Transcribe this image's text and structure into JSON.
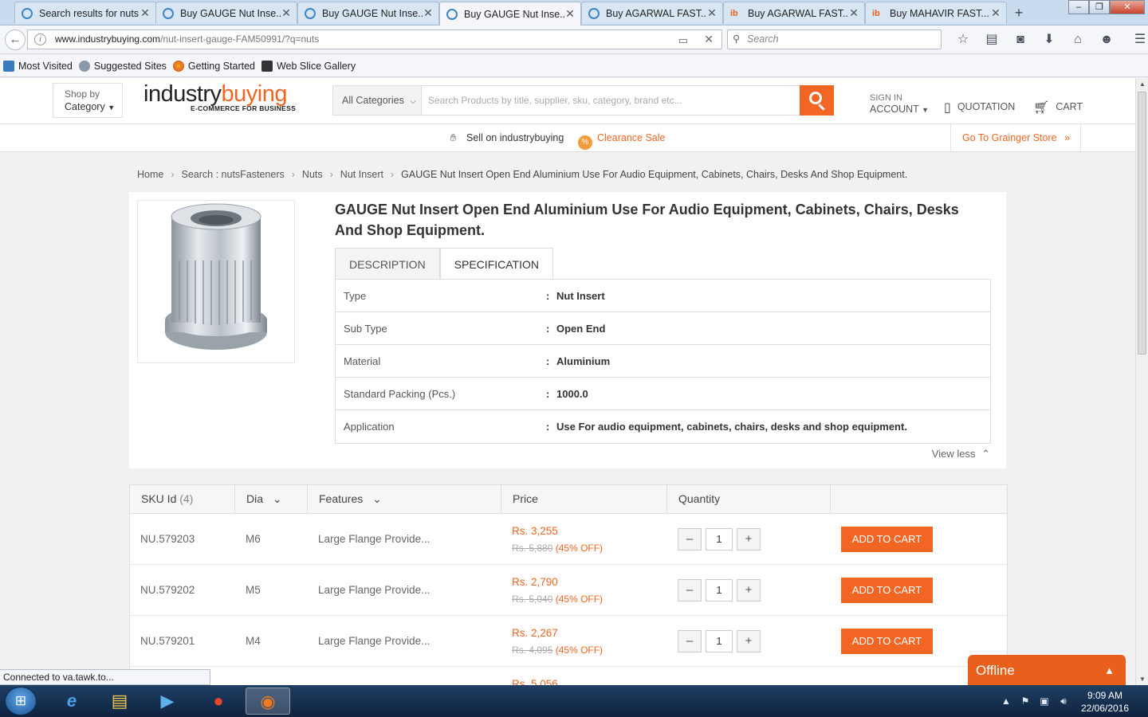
{
  "browser": {
    "tabs": [
      {
        "label": "Search results for nuts",
        "icon": "loading-icon"
      },
      {
        "label": "Buy GAUGE Nut Inse...",
        "icon": "loading-icon"
      },
      {
        "label": "Buy GAUGE Nut Inse...",
        "icon": "loading-icon"
      },
      {
        "label": "Buy GAUGE Nut Inse...",
        "icon": "loading-icon",
        "active": true
      },
      {
        "label": "Buy AGARWAL FAST...",
        "icon": "loading-icon"
      },
      {
        "label": "Buy AGARWAL FAST...",
        "icon": "ib-favicon"
      },
      {
        "label": "Buy MAHAVIR FAST...",
        "icon": "ib-favicon"
      }
    ],
    "url_host": "www.industrybuying.com",
    "url_path": "/nut-insert-gauge-FAM50991/?q=nuts",
    "search_placeholder": "Search",
    "bookmarks": [
      "Most Visited",
      "Suggested Sites",
      "Getting Started",
      "Web Slice Gallery"
    ],
    "status_text": "Connected to va.tawk.to..."
  },
  "site": {
    "shop_by": "Shop by",
    "shop_category": "Category",
    "logo_part1": "industry",
    "logo_part2": "buying",
    "logo_tagline": "E-COMMERCE FOR BUSINESS",
    "all_categories": "All Categories",
    "search_placeholder": "Search Products by title, supplier, sku, category, brand etc...",
    "sign_in": "SIGN IN",
    "account": "ACCOUNT",
    "quotation": "QUOTATION",
    "cart": "CART",
    "sell": "Sell on industrybuying",
    "clearance": "Clearance Sale",
    "grainger": "Go To Grainger Store",
    "brand_color": "#f26522"
  },
  "breadcrumb": [
    "Home",
    "Search : nutsFasteners",
    "Nuts",
    "Nut Insert",
    "GAUGE Nut Insert Open End Aluminium Use For Audio Equipment, Cabinets, Chairs, Desks And Shop Equipment."
  ],
  "product": {
    "title": "GAUGE Nut Insert Open End Aluminium Use For Audio Equipment, Cabinets, Chairs, Desks And Shop Equipment.",
    "tabs": [
      "DESCRIPTION",
      "SPECIFICATION"
    ],
    "specs": [
      {
        "key": "Type",
        "value": "Nut Insert"
      },
      {
        "key": "Sub Type",
        "value": "Open End"
      },
      {
        "key": "Material",
        "value": "Aluminium"
      },
      {
        "key": "Standard Packing (Pcs.)",
        "value": "1000.0"
      },
      {
        "key": "Application",
        "value": "Use For audio equipment, cabinets, chairs, desks and shop equipment."
      }
    ],
    "view_less": "View less"
  },
  "sku_table": {
    "headers": {
      "sku": "SKU Id",
      "sku_count": "(4)",
      "dia": "Dia",
      "features": "Features",
      "price": "Price",
      "quantity": "Quantity"
    },
    "rows": [
      {
        "sku": "NU.579203",
        "dia": "M6",
        "features": "Large Flange Provide...",
        "price": "Rs. 3,255",
        "mrp": "Rs. 5,880",
        "off": "(45% OFF)",
        "qty": "1",
        "button": "ADD TO CART"
      },
      {
        "sku": "NU.579202",
        "dia": "M5",
        "features": "Large Flange Provide...",
        "price": "Rs. 2,790",
        "mrp": "Rs. 5,040",
        "off": "(45% OFF)",
        "qty": "1",
        "button": "ADD TO CART"
      },
      {
        "sku": "NU.579201",
        "dia": "M4",
        "features": "Large Flange Provide...",
        "price": "Rs. 2,267",
        "mrp": "Rs. 4,095",
        "off": "(45% OFF)",
        "qty": "1",
        "button": "ADD TO CART"
      },
      {
        "sku": "",
        "dia": "",
        "features": "",
        "price": "Rs. 5,056",
        "mrp": "",
        "off": "",
        "qty": "",
        "button": ""
      }
    ]
  },
  "chat": {
    "label": "Offline"
  },
  "taskbar": {
    "time": "9:09 AM",
    "date": "22/06/2016"
  }
}
